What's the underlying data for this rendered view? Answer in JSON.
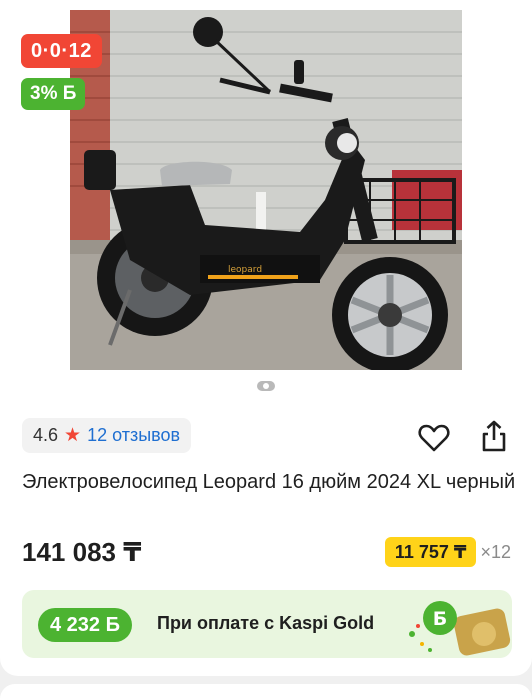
{
  "badges": {
    "installment": "0·0·12",
    "bonus": "3% Б"
  },
  "rating": {
    "value": "4.6",
    "reviews": "12 отзывов"
  },
  "product": {
    "title": "Электровелосипед Leopard 16 дюйм 2024 XL черный",
    "price": "141 083 ₸",
    "monthly_price": "11 757 ₸",
    "months": "×12",
    "scooter_logo": "leopard"
  },
  "kaspi_gold": {
    "bonus": "4 232 Б",
    "text": "При оплате с Kaspi Gold",
    "coin_letter": "Б"
  },
  "colors": {
    "accent_red": "#f14635",
    "bonus_green": "#4cb331",
    "price_yellow": "#ffd319",
    "link_blue": "#1f6fd1"
  }
}
